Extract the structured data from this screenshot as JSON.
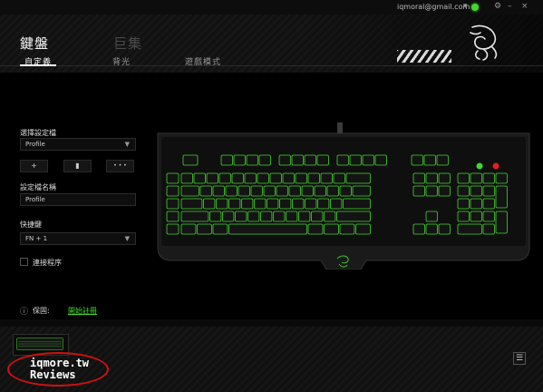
{
  "window": {
    "email": "iqmoral@gmail.com",
    "settings_icon": "gear-icon",
    "minimize_label": "–",
    "close_label": "×"
  },
  "header": {
    "title": "鍵盤",
    "ghost_title": "巨集",
    "tabs": [
      {
        "label": "自定義",
        "active": true
      },
      {
        "label": "背光",
        "active": false
      },
      {
        "label": "遊戲模式",
        "active": false
      }
    ]
  },
  "left_panel": {
    "profile_label": "選擇設定檔",
    "profile_value": "Profile",
    "add_label": "+",
    "delete_label": "🗑",
    "more_label": "• • •",
    "profile_name_label": "設定檔名稱",
    "profile_name_value": "Profile",
    "shortcut_label": "快捷鍵",
    "shortcut_value": "FN + 1",
    "link_program_label": "連接程序"
  },
  "bottom": {
    "warranty_label": "保固:",
    "register_link": "開始註冊"
  },
  "watermark": {
    "line1": "iqmore.tw",
    "line2": "Reviews"
  },
  "colors": {
    "accent": "#44d62c",
    "background": "#000000"
  }
}
